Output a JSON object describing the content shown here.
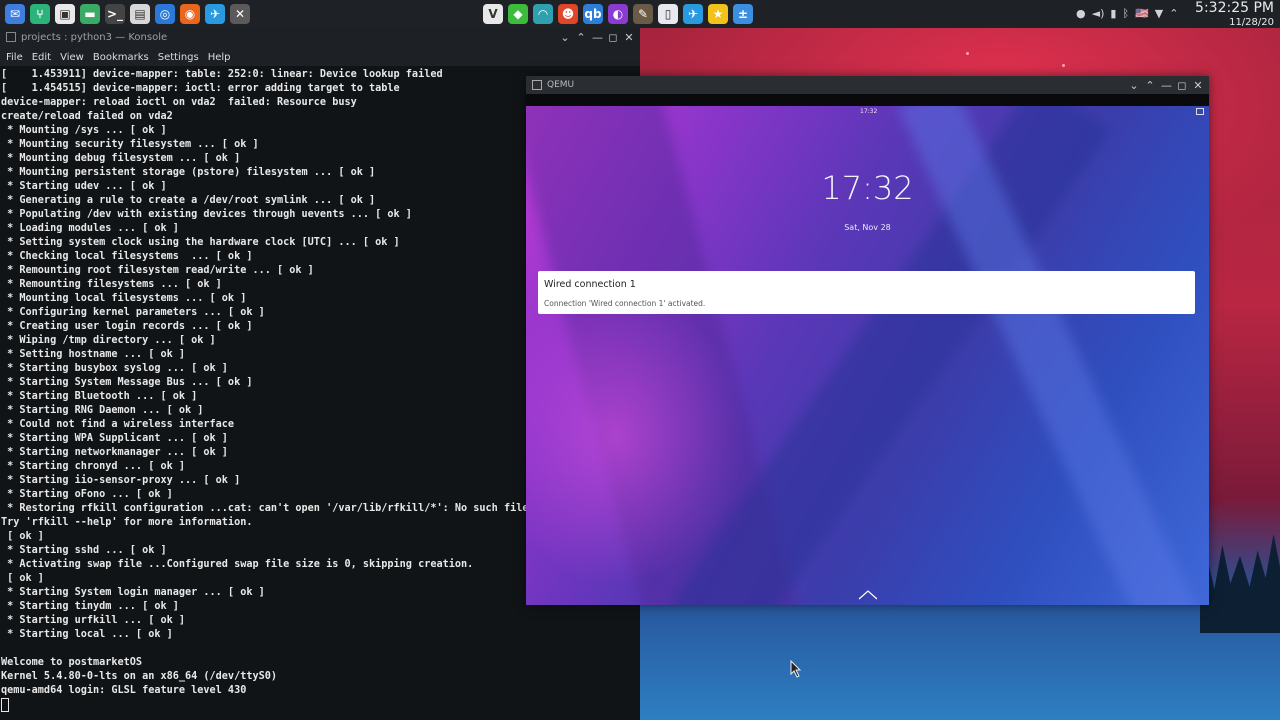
{
  "panel": {
    "launchers": [
      {
        "icon": "mail-icon",
        "color": "#3d7ee0",
        "glyph": "✉"
      },
      {
        "icon": "git-icon",
        "color": "#2bb37a",
        "glyph": "⑂"
      },
      {
        "icon": "bag-icon",
        "color": "#e9e9e9",
        "glyph": "▣"
      },
      {
        "icon": "folder-icon",
        "color": "#3aaa67",
        "glyph": "▬"
      },
      {
        "icon": "terminal-icon",
        "color": "#444",
        "glyph": ">_"
      },
      {
        "icon": "files-icon",
        "color": "#d8d8d8",
        "glyph": "▤"
      },
      {
        "icon": "browser-icon",
        "color": "#2a78d8",
        "glyph": "◎"
      },
      {
        "icon": "firefox-icon",
        "color": "#e8661e",
        "glyph": "◉"
      },
      {
        "icon": "telegram-settings-icon",
        "color": "#2a9ae0",
        "glyph": "✈"
      },
      {
        "icon": "close-x-icon",
        "color": "#5a5a5a",
        "glyph": "✕"
      }
    ],
    "tasks": [
      {
        "icon": "vivaldi-icon",
        "color": "#e8e8e8",
        "glyph": "V"
      },
      {
        "icon": "cube-icon",
        "color": "#3dbb3d",
        "glyph": "◆"
      },
      {
        "icon": "speedometer-icon",
        "color": "#2ea0b0",
        "glyph": "◠"
      },
      {
        "icon": "robot-icon",
        "color": "#e0462a",
        "glyph": "☻"
      },
      {
        "icon": "qbittorrent-icon",
        "color": "#2d7ed8",
        "glyph": "qb"
      },
      {
        "icon": "color-picker-icon",
        "color": "#8a3bd0",
        "glyph": "◐"
      },
      {
        "icon": "gimp-icon",
        "color": "#6b5a45",
        "glyph": "✎"
      },
      {
        "icon": "document-icon",
        "color": "#e8e8f0",
        "glyph": "▯"
      },
      {
        "icon": "telegram-icon",
        "color": "#2a9ae0",
        "glyph": "✈"
      },
      {
        "icon": "star-icon",
        "color": "#f2c21b",
        "glyph": "★"
      },
      {
        "icon": "calculator-icon",
        "color": "#3b8ee0",
        "glyph": "±"
      }
    ],
    "tray": [
      "●",
      "◄)",
      "▮",
      "ᛒ",
      "🇺🇸",
      "▼",
      "⌃"
    ],
    "clock_time": "5:32:25 PM",
    "clock_date": "11/28/20"
  },
  "konsole": {
    "title": "projects : python3 — Konsole",
    "menu": [
      "File",
      "Edit",
      "View",
      "Bookmarks",
      "Settings",
      "Help"
    ],
    "lines": [
      "[    1.453911] device-mapper: table: 252:0: linear: Device lookup failed",
      "[    1.454515] device-mapper: ioctl: error adding target to table",
      "device-mapper: reload ioctl on vda2  failed: Resource busy",
      "create/reload failed on vda2",
      " * Mounting /sys ... [ ok ]",
      " * Mounting security filesystem ... [ ok ]",
      " * Mounting debug filesystem ... [ ok ]",
      " * Mounting persistent storage (pstore) filesystem ... [ ok ]",
      " * Starting udev ... [ ok ]",
      " * Generating a rule to create a /dev/root symlink ... [ ok ]",
      " * Populating /dev with existing devices through uevents ... [ ok ]",
      " * Loading modules ... [ ok ]",
      " * Setting system clock using the hardware clock [UTC] ... [ ok ]",
      " * Checking local filesystems  ... [ ok ]",
      " * Remounting root filesystem read/write ... [ ok ]",
      " * Remounting filesystems ... [ ok ]",
      " * Mounting local filesystems ... [ ok ]",
      " * Configuring kernel parameters ... [ ok ]",
      " * Creating user login records ... [ ok ]",
      " * Wiping /tmp directory ... [ ok ]",
      " * Setting hostname ... [ ok ]",
      " * Starting busybox syslog ... [ ok ]",
      " * Starting System Message Bus ... [ ok ]",
      " * Starting Bluetooth ... [ ok ]",
      " * Starting RNG Daemon ... [ ok ]",
      " * Could not find a wireless interface",
      " * Starting WPA Supplicant ... [ ok ]",
      " * Starting networkmanager ... [ ok ]",
      " * Starting chronyd ... [ ok ]",
      " * Starting iio-sensor-proxy ... [ ok ]",
      " * Starting oFono ... [ ok ]",
      " * Restoring rfkill configuration ...cat: can't open '/var/lib/rfkill/*': No such file o",
      "Try 'rfkill --help' for more information.",
      " [ ok ]",
      " * Starting sshd ... [ ok ]",
      " * Activating swap file ...Configured swap file size is 0, skipping creation.",
      " [ ok ]",
      " * Starting System login manager ... [ ok ]",
      " * Starting tinydm ... [ ok ]",
      " * Starting urfkill ... [ ok ]",
      " * Starting local ... [ ok ]",
      "",
      "Welcome to postmarketOS",
      "Kernel 5.4.80-0-lts on an x86_64 (/dev/ttyS0)",
      "qemu-amd64 login: GLSL feature level 430"
    ]
  },
  "qemu": {
    "title": "QEMU",
    "statusbar_time": "17:32",
    "lock_time": "17:32",
    "lock_date": "Sat, Nov 28",
    "notification": {
      "title": "Wired connection 1",
      "body": "Connection 'Wired connection 1' activated."
    }
  },
  "window_buttons": [
    "⌄",
    "⌃",
    "—",
    "◻",
    "✕"
  ]
}
